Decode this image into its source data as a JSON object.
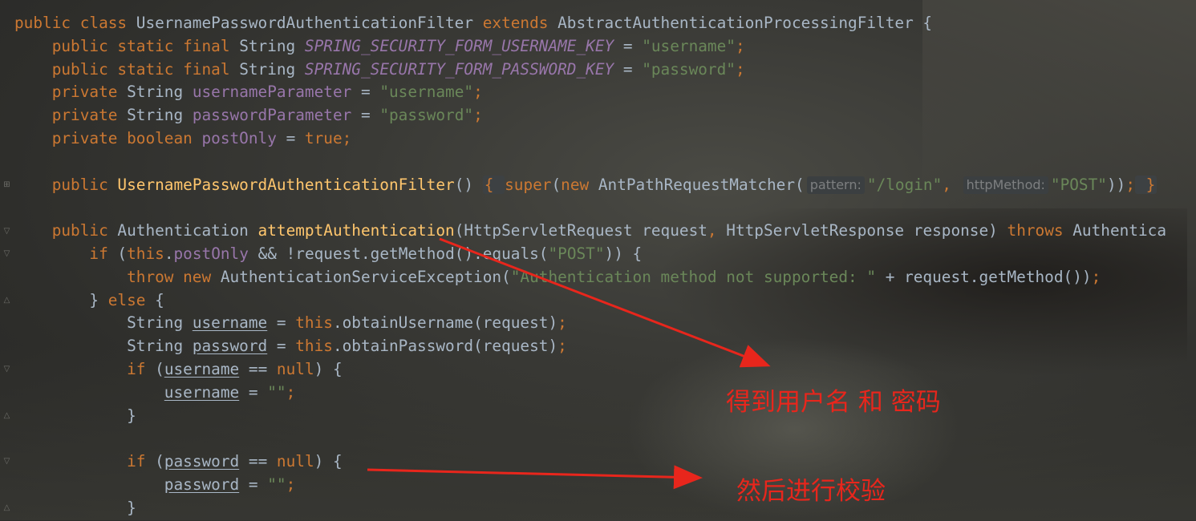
{
  "editor": {
    "lines": [
      {
        "tokens": [
          [
            "kw",
            "public class "
          ],
          [
            "cls",
            "UsernamePasswordAuthenticationFilter "
          ],
          [
            "kw",
            "extends "
          ],
          [
            "cls",
            "AbstractAuthenticationProcessingFilter {"
          ]
        ]
      },
      {
        "tokens": [
          [
            "kw",
            "    public static final "
          ],
          [
            "cls",
            "String "
          ],
          [
            "cst",
            "SPRING_SECURITY_FORM_USERNAME_KEY"
          ],
          [
            "plain",
            " = "
          ],
          [
            "str",
            "\"username\""
          ],
          [
            "kw",
            ";"
          ]
        ]
      },
      {
        "tokens": [
          [
            "kw",
            "    public static final "
          ],
          [
            "cls",
            "String "
          ],
          [
            "cst",
            "SPRING_SECURITY_FORM_PASSWORD_KEY"
          ],
          [
            "plain",
            " = "
          ],
          [
            "str",
            "\"password\""
          ],
          [
            "kw",
            ";"
          ]
        ]
      },
      {
        "tokens": [
          [
            "kw",
            "    private "
          ],
          [
            "cls",
            "String "
          ],
          [
            "fld",
            "usernameParameter"
          ],
          [
            "plain",
            " = "
          ],
          [
            "str",
            "\"username\""
          ],
          [
            "kw",
            ";"
          ]
        ]
      },
      {
        "tokens": [
          [
            "kw",
            "    private "
          ],
          [
            "cls",
            "String "
          ],
          [
            "fld",
            "passwordParameter"
          ],
          [
            "plain",
            " = "
          ],
          [
            "str",
            "\"password\""
          ],
          [
            "kw",
            ";"
          ]
        ]
      },
      {
        "tokens": [
          [
            "kw",
            "    private boolean "
          ],
          [
            "fld",
            "postOnly"
          ],
          [
            "plain",
            " = "
          ],
          [
            "kw",
            "true;"
          ]
        ]
      },
      {
        "tokens": []
      },
      {
        "tokens": [
          [
            "kw",
            "    public "
          ],
          [
            "mth",
            "UsernamePasswordAuthenticationFilter"
          ],
          [
            "plain",
            "() "
          ],
          [
            "fold",
            "{ "
          ],
          [
            "kw",
            "super"
          ],
          [
            "plain",
            "("
          ],
          [
            "kw",
            "new "
          ],
          [
            "cls",
            "AntPathRequestMatcher("
          ],
          [
            "hint",
            "pattern:"
          ],
          [
            "str",
            "\"/login\""
          ],
          [
            "kw",
            ", "
          ],
          [
            "hint",
            "httpMethod:"
          ],
          [
            "str",
            "\"POST\""
          ],
          [
            "plain",
            "))"
          ],
          [
            "kw",
            ";"
          ],
          [
            "fold",
            " }"
          ]
        ]
      },
      {
        "tokens": []
      },
      {
        "tokens": [
          [
            "kw",
            "    public "
          ],
          [
            "cls",
            "Authentication "
          ],
          [
            "mth",
            "attemptAuthentication"
          ],
          [
            "plain",
            "(HttpServletRequest request"
          ],
          [
            "kw",
            ", "
          ],
          [
            "plain",
            "HttpServletResponse response) "
          ],
          [
            "kw",
            "throws "
          ],
          [
            "cls",
            "Authentica"
          ]
        ]
      },
      {
        "tokens": [
          [
            "kw",
            "        if "
          ],
          [
            "plain",
            "("
          ],
          [
            "kw",
            "this"
          ],
          [
            "plain",
            "."
          ],
          [
            "fld",
            "postOnly"
          ],
          [
            "plain",
            " && !request.getMethod().equals("
          ],
          [
            "str",
            "\"POST\""
          ],
          [
            "plain",
            ")) {"
          ]
        ]
      },
      {
        "tokens": [
          [
            "kw",
            "            throw new "
          ],
          [
            "cls",
            "AuthenticationServiceException("
          ],
          [
            "str",
            "\"Authentication method not supported: \""
          ],
          [
            "plain",
            " + request.getMethod())"
          ],
          [
            "kw",
            ";"
          ]
        ]
      },
      {
        "tokens": [
          [
            "plain",
            "        } "
          ],
          [
            "kw",
            "else "
          ],
          [
            "plain",
            "{"
          ]
        ]
      },
      {
        "tokens": [
          [
            "cls",
            "            String "
          ],
          [
            "var",
            "username"
          ],
          [
            "plain",
            " = "
          ],
          [
            "kw",
            "this"
          ],
          [
            "plain",
            ".obtainUsername(request)"
          ],
          [
            "kw",
            ";"
          ]
        ]
      },
      {
        "tokens": [
          [
            "cls",
            "            String "
          ],
          [
            "var",
            "password"
          ],
          [
            "plain",
            " = "
          ],
          [
            "kw",
            "this"
          ],
          [
            "plain",
            ".obtainPassword(request)"
          ],
          [
            "kw",
            ";"
          ]
        ]
      },
      {
        "tokens": [
          [
            "kw",
            "            if "
          ],
          [
            "plain",
            "("
          ],
          [
            "var",
            "username"
          ],
          [
            "plain",
            " == "
          ],
          [
            "kw",
            "null"
          ],
          [
            "plain",
            ") {"
          ]
        ]
      },
      {
        "tokens": [
          [
            "plain",
            "                "
          ],
          [
            "var",
            "username"
          ],
          [
            "plain",
            " = "
          ],
          [
            "str",
            "\"\""
          ],
          [
            "kw",
            ";"
          ]
        ]
      },
      {
        "tokens": [
          [
            "plain",
            "            }"
          ]
        ]
      },
      {
        "tokens": []
      },
      {
        "tokens": [
          [
            "kw",
            "            if "
          ],
          [
            "plain",
            "("
          ],
          [
            "var",
            "password"
          ],
          [
            "plain",
            " == "
          ],
          [
            "kw",
            "null"
          ],
          [
            "plain",
            ") {"
          ]
        ]
      },
      {
        "tokens": [
          [
            "plain",
            "                "
          ],
          [
            "var",
            "password"
          ],
          [
            "plain",
            " = "
          ],
          [
            "str",
            "\"\""
          ],
          [
            "kw",
            ";"
          ]
        ]
      },
      {
        "tokens": [
          [
            "plain",
            "            }"
          ]
        ]
      }
    ]
  },
  "annotations": {
    "note1": "得到用户名 和 密码",
    "note2": "然后进行校验",
    "arrow_color": "#e8261c"
  },
  "colors": {
    "keyword": "#cc7832",
    "string": "#6a8759",
    "field": "#9876aa",
    "method": "#ffc66d",
    "text": "#a9b7c6"
  }
}
